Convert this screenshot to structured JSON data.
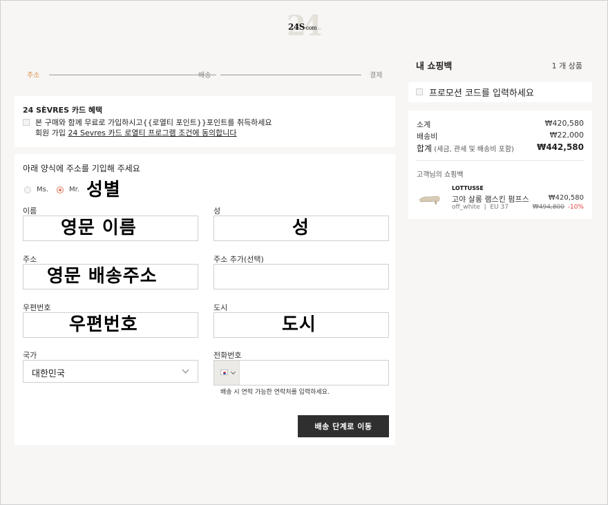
{
  "logo": {
    "text": "24S",
    "suffix": "·com"
  },
  "stepper": {
    "steps": [
      "주소",
      "배송",
      "결제"
    ]
  },
  "benefit": {
    "title": "24 SÈVRES 카드 혜택",
    "line1": "본 구매와 함께 무료로 가입하시고{{로열티 포인트}}포인트를 취득하세요",
    "line2_prefix": "회원 가입 ",
    "line2_link": "24 Sevres 카드 로열티 프로그램 조건에 동의합니다"
  },
  "form": {
    "title": "아래 양식에 주소를 기입해 주세요",
    "gender": {
      "ms": "Ms.",
      "mr": "Mr.",
      "selected": "mr",
      "overlay": "성별"
    },
    "first_name": {
      "label": "이름",
      "overlay": "영문 이름"
    },
    "last_name": {
      "label": "성",
      "overlay": "성"
    },
    "address": {
      "label": "주소",
      "overlay": "영문 배송주소"
    },
    "address2": {
      "label": "주소 추가(선택)",
      "value": ""
    },
    "postcode": {
      "label": "우편번호",
      "overlay": "우편번호"
    },
    "city": {
      "label": "도시",
      "overlay": "도시"
    },
    "country": {
      "label": "국가",
      "value": "대한민국"
    },
    "phone": {
      "label": "전화번호",
      "value": "",
      "hint": "배송 시 연락 가능한 연락처를 입력하세요."
    },
    "submit_label": "배송 단계로 이동"
  },
  "bag": {
    "title": "내 쇼핑백",
    "count": "1 개 상품",
    "promo_label": "프로모션 코드를 입력하세요",
    "subtotal_label": "소계",
    "subtotal_value": "₩420,580",
    "shipping_label": "배송비",
    "shipping_value": "₩22,000",
    "total_label": "합계",
    "total_sub": " (세금, 관세 및 배송비 포함)",
    "total_value": "₩442,580",
    "customer_bag_label": "고객님의 쇼핑백",
    "item": {
      "brand": "LOTTUSSE",
      "name": "고야 살롱 램스킨 펌프스",
      "color": "off_white",
      "size": "EU 37",
      "price": "₩420,580",
      "old_price": "₩494,800",
      "discount": "-10%"
    }
  }
}
